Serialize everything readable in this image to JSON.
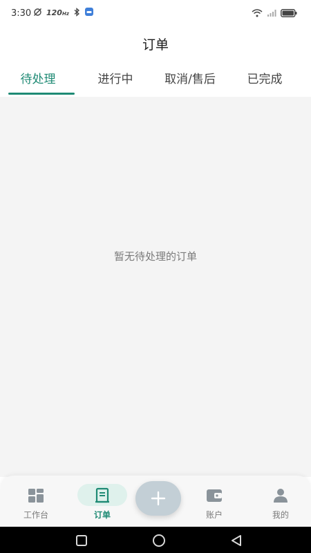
{
  "status_bar": {
    "time": "3:30",
    "refresh_rate": "120",
    "refresh_unit": "Hz"
  },
  "header": {
    "title": "订单"
  },
  "tabs": [
    {
      "label": "待处理",
      "active": true
    },
    {
      "label": "进行中",
      "active": false
    },
    {
      "label": "取消/售后",
      "active": false
    },
    {
      "label": "已完成",
      "active": false
    }
  ],
  "content": {
    "empty_message": "暂无待处理的订单"
  },
  "bottom_nav": {
    "items": [
      {
        "label": "工作台",
        "icon": "dashboard-icon"
      },
      {
        "label": "订单",
        "icon": "order-icon",
        "active": true
      },
      {
        "label": "账户",
        "icon": "wallet-icon"
      },
      {
        "label": "我的",
        "icon": "person-icon"
      }
    ],
    "add_icon": "plus-icon"
  },
  "colors": {
    "accent": "#1e8a74",
    "accent_light": "#dff1ec",
    "content_bg": "#f4f4f4",
    "nav_bg": "#f7f7f7",
    "add_button_bg": "#c3cfd6"
  }
}
